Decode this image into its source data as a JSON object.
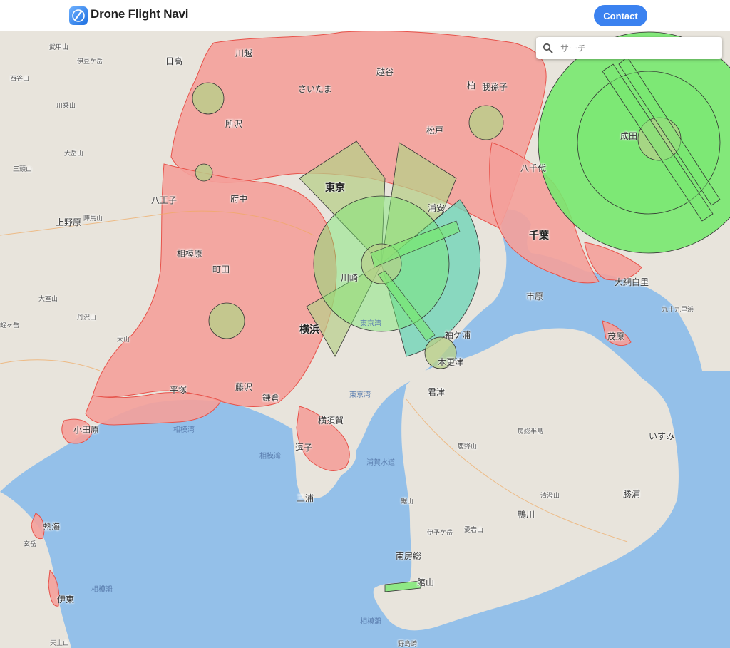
{
  "header": {
    "brand": "Drone Flight Navi",
    "contact_label": "Contact"
  },
  "search": {
    "placeholder": "サーチ"
  },
  "colors": {
    "land": "#e8e4dc",
    "sea": "#94c0e9",
    "did_area": "#f4a09a",
    "did_border": "#e7524a",
    "airport_zone_green": "#78e86f",
    "airport_zone_olive": "#b8cf8a",
    "airport_zone_teal": "#70d4b8",
    "contact_button": "#3b82f0"
  },
  "map": {
    "labels": {
      "hidaka": "日高",
      "kawagoe": "川越",
      "koshigaya": "越谷",
      "saitama": "さいたま",
      "kashiwa": "柏",
      "abiko": "我孫子",
      "matsudo": "松戸",
      "tokorozawa": "所沢",
      "narita": "成田",
      "hachiyo": "八千代",
      "hachioji": "八王子",
      "fuchu": "府中",
      "tokyo": "東京",
      "urayasu": "浦安",
      "chiba": "千葉",
      "sagamihara": "相模原",
      "machida": "町田",
      "kawasaki": "川崎",
      "ichihara": "市原",
      "oamishirasato": "大網白里",
      "yokohama": "横浜",
      "tokyo_bay_inner": "東京湾",
      "sodegaura": "袖ケ浦",
      "kisarazu": "木更津",
      "mobara": "茂原",
      "hiratsuka": "平塚",
      "fujisawa": "藤沢",
      "kamakura": "鎌倉",
      "kimitsu": "君津",
      "tokyo_bay": "東京湾",
      "odawara": "小田原",
      "sagami_bay": "相模湾",
      "sagami_bay_2": "相模湾",
      "yokosuka": "横須賀",
      "zushi": "逗子",
      "uraga_channel": "浦賀水道",
      "boso_hanto": "房総半島",
      "isumi": "いすみ",
      "miura": "三浦",
      "kyunanaku_beach": "九十九里浜",
      "katsuura": "勝浦",
      "kamogawa": "鴨川",
      "minamiboso": "南房総",
      "tateyama": "館山",
      "atami": "熱海",
      "ito": "伊東",
      "sagami_nada": "相模灘",
      "sagami_nada_2": "相模灘",
      "nojimazaki": "野島崎",
      "mt_bukou": "武甲山",
      "mt_izugatake": "伊豆ケ岳",
      "mt_nishitanzawa": "西谷山",
      "mt_kawanori": "川乗山",
      "mt_ootake": "大岳山",
      "mt_mitou": "三頭山",
      "mt_jinba": "陣馬山",
      "uenohara": "上野原",
      "mt_oomuro": "大室山",
      "mt_tanzawa": "丹沢山",
      "mt_hiruga": "蛭ヶ岳",
      "mt_ooyama": "大山",
      "mt_kanoh": "鹿野山",
      "mt_nokogiri": "鋸山",
      "mt_kiyosumi": "清澄山",
      "mt_iyogatake": "伊予ケ岳",
      "mt_atago": "愛宕山",
      "genka": "玄岳",
      "tenjo": "天上山"
    }
  }
}
